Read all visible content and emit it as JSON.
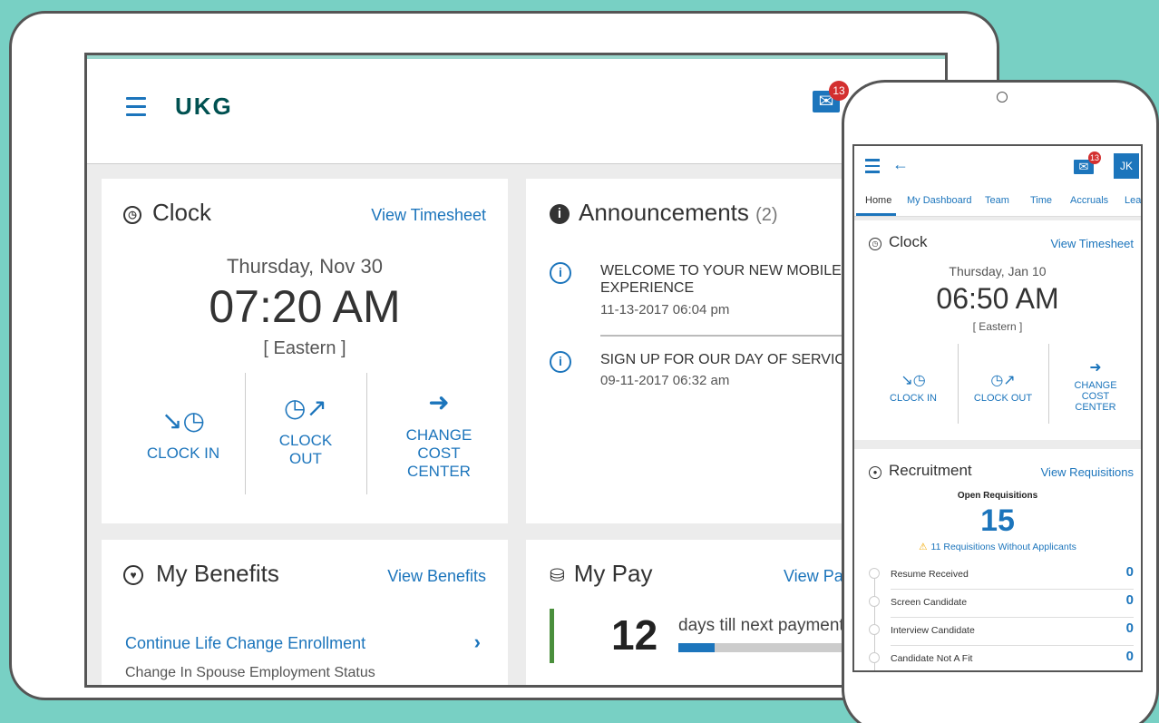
{
  "colors": {
    "accent": "#1c75bc",
    "background": "#78d0c4",
    "badge": "#d32f2f",
    "logo": "#005151",
    "pay_bar": "#4a8f3c"
  },
  "tablet": {
    "logo": "UKG",
    "mail_badge": "13",
    "clock": {
      "title": "Clock",
      "link": "View Timesheet",
      "date": "Thursday, Nov 30",
      "time": "07:20 AM",
      "timezone": "[ Eastern ]",
      "actions": [
        {
          "icon": "clock-in-icon",
          "label": "CLOCK IN"
        },
        {
          "icon": "clock-out-icon",
          "label": "CLOCK OUT"
        },
        {
          "icon": "arrow-right-icon",
          "label": "CHANGE COST CENTER"
        }
      ]
    },
    "announcements": {
      "title": "Announcements",
      "count": "(2)",
      "items": [
        {
          "title": "WELCOME TO YOUR NEW MOBILE EXPERIENCE",
          "date": "11-13-2017 06:04 pm"
        },
        {
          "title": "SIGN UP FOR OUR DAY OF SERVICE!",
          "date": "09-11-2017 06:32 am"
        }
      ]
    },
    "benefits": {
      "title": "My Benefits",
      "link": "View Benefits",
      "item_title": "Continue Life Change Enrollment",
      "item_sub": "Change In Spouse Employment Status"
    },
    "pay": {
      "title": "My Pay",
      "link": "View Pay",
      "days": "12",
      "days_label": "days till next payment",
      "progress": 0.2
    }
  },
  "phone": {
    "mail_badge": "13",
    "avatar": "JK",
    "tabs": [
      "Home",
      "My Dashboard",
      "Team",
      "Time",
      "Accruals",
      "Leave"
    ],
    "clock": {
      "title": "Clock",
      "link": "View Timesheet",
      "date": "Thursday, Jan 10",
      "time": "06:50 AM",
      "timezone": "[ Eastern ]",
      "actions": [
        {
          "icon": "clock-in-icon",
          "label": "CLOCK IN"
        },
        {
          "icon": "clock-out-icon",
          "label": "CLOCK OUT"
        },
        {
          "icon": "arrow-right-icon",
          "label": "CHANGE COST CENTER"
        }
      ]
    },
    "recruitment": {
      "title": "Recruitment",
      "link": "View Requisitions",
      "open_label": "Open Requisitions",
      "open_count": "15",
      "warning": "11 Requisitions Without Applicants",
      "rows": [
        {
          "label": "Resume Received",
          "value": "0"
        },
        {
          "label": "Screen Candidate",
          "value": "0"
        },
        {
          "label": "Interview Candidate",
          "value": "0"
        },
        {
          "label": "Candidate Not A Fit",
          "value": "0"
        }
      ]
    }
  }
}
